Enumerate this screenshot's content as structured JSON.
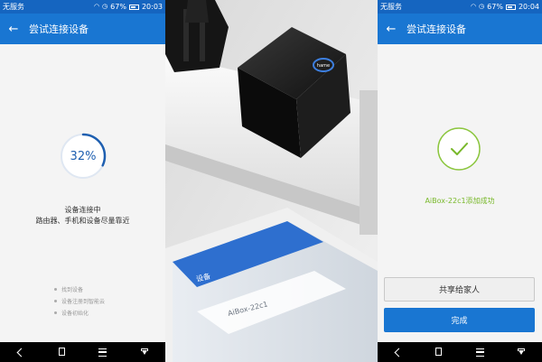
{
  "left_screen": {
    "status": {
      "carrier": "无服务",
      "battery": "67%",
      "time": "20:03",
      "battery_fraction": 0.67
    },
    "appbar": {
      "title": "尝试连接设备"
    },
    "progress": {
      "value": 32,
      "label": "32%"
    },
    "message": {
      "title": "设备连接中",
      "subtitle": "路由器、手机和设备尽量靠近"
    },
    "steps": [
      "找到设备",
      "设备注册到智能云",
      "设备初始化"
    ]
  },
  "right_screen": {
    "status": {
      "carrier": "无服务",
      "battery": "67%",
      "time": "20:04",
      "battery_fraction": 0.67
    },
    "appbar": {
      "title": "尝试连接设备"
    },
    "success_message": "AiBox-22c1添加成功",
    "share_button": "共享给家人",
    "done_button": "完成"
  },
  "photo": {
    "device_badge": "hame",
    "phone_screen_title": "设备",
    "phone_list_item": "AiBox-22c1"
  },
  "colors": {
    "primary_blue": "#1976d2",
    "status_blue": "#1565c0",
    "success_green": "#78b82a",
    "progress_blue": "#1e5fb0"
  }
}
